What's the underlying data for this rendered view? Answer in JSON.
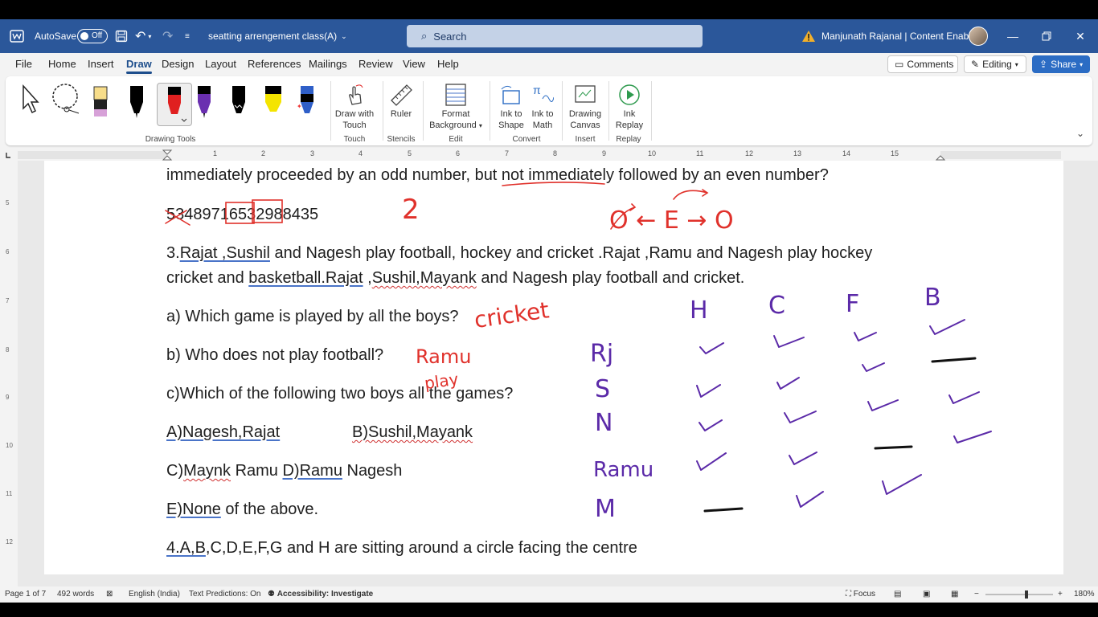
{
  "titlebar": {
    "autosave_label": "AutoSave",
    "autosave_state": "Off",
    "doc_title": "seatting arrengement class(A)",
    "search_placeholder": "Search",
    "user_name": "Manjunath Rajanal | Content Enablers"
  },
  "menu": {
    "tabs": [
      "File",
      "Home",
      "Insert",
      "Draw",
      "Design",
      "Layout",
      "References",
      "Mailings",
      "Review",
      "View",
      "Help"
    ],
    "active_tab": "Draw",
    "comments_label": "Comments",
    "editing_label": "Editing",
    "share_label": "Share"
  },
  "ribbon": {
    "drawing_tools_label": "Drawing Tools",
    "draw_with_touch": [
      "Draw with",
      "Touch"
    ],
    "touch_group": "Touch",
    "ruler": "Ruler",
    "stencils_group": "Stencils",
    "format_background": [
      "Format",
      "Background"
    ],
    "edit_group": "Edit",
    "ink_to_shape": [
      "Ink to",
      "Shape"
    ],
    "ink_to_math": [
      "Ink to",
      "Math"
    ],
    "convert_group": "Convert",
    "drawing_canvas": [
      "Drawing",
      "Canvas"
    ],
    "insert_group": "Insert",
    "ink_replay": [
      "Ink",
      "Replay"
    ],
    "replay_group": "Replay",
    "pen_colors": [
      "#000000",
      "#000000",
      "#e02020",
      "#6a2fb0",
      "#000000",
      "#f4e400",
      "#2f5fc8"
    ]
  },
  "ruler": {
    "h_numbers": [
      "1",
      "2",
      "3",
      "4",
      "5",
      "6",
      "7",
      "8",
      "9",
      "10",
      "11",
      "12",
      "13",
      "14",
      "15"
    ],
    "v_numbers": [
      "5",
      "6",
      "7",
      "8",
      "9",
      "10",
      "11",
      "12"
    ]
  },
  "document": {
    "l1": "immediately proceeded by an odd number, but not immediately followed by an even number?",
    "l2": "53489716532988435",
    "l3a": "3.",
    "l3b": "Rajat ,Sushil",
    "l3c": " and Nagesh play football, hockey and cricket .Rajat ,Ramu and Nagesh play hockey",
    "l4a": "cricket and ",
    "l4b": "basketball.Rajat",
    "l4c": " ,",
    "l4d": "Sushil,Mayank",
    "l4e": " and Nagesh play football and cricket.",
    "qa": "a) Which game is played by all the boys?",
    "qb": "b) Who does not play football?",
    "qc": "c)Which of the following two boys all the games?",
    "oa": "A)Nagesh,Rajat",
    "ob": "B)Sushil,Mayank",
    "oc1": "C)",
    "oc2": "Maynk",
    "oc3": " Ramu  ",
    "od1": "D)Ramu",
    "od2": " Nagesh",
    "oe1": "E)None",
    "oe2": " of the above.",
    "l4q1": "4.A,B",
    "l4q2": ",C,D,E,F,G and H are sitting around a circle facing the centre"
  },
  "ink": {
    "red_number": "2",
    "red_expr": "O ← E → O",
    "red_answer_a": "cricket",
    "red_answer_b1": "Ramu",
    "red_answer_b2": "play",
    "col_headers": [
      "H",
      "C",
      "F",
      "B"
    ],
    "row_labels": [
      "Rj",
      "S",
      "N",
      "Ramu",
      "M"
    ],
    "red_color": "#e0312b",
    "purple_color": "#5b2aa8"
  },
  "status": {
    "page": "Page 1 of 7",
    "words": "492 words",
    "language": "English (India)",
    "predictions": "Text Predictions: On",
    "accessibility": "Accessibility: Investigate",
    "focus": "Focus",
    "zoom": "180%"
  }
}
